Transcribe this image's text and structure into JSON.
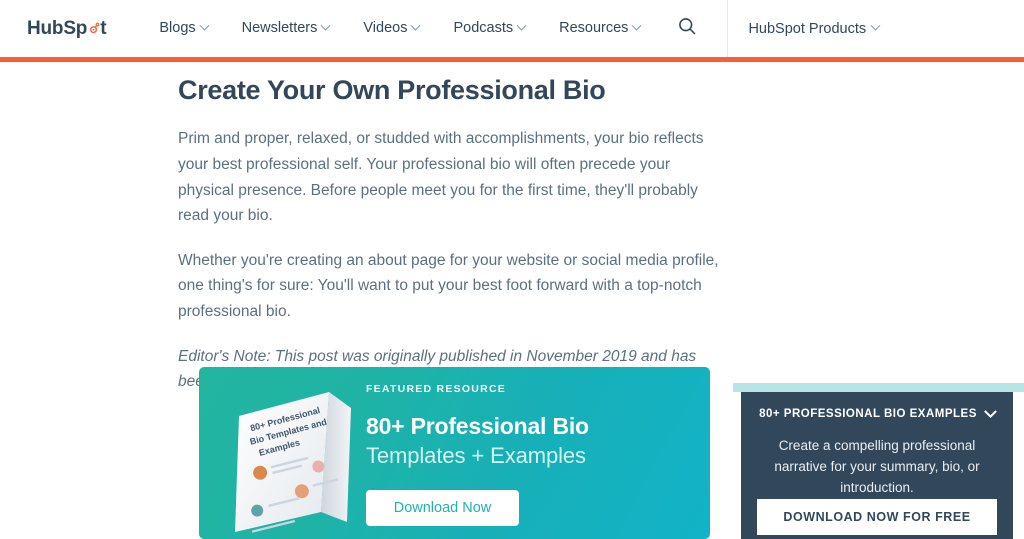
{
  "header": {
    "logo": {
      "text_a": "HubSp",
      "text_b": "t",
      "icon": "hubspot-sprocket-icon"
    },
    "nav_items": [
      {
        "label": "Blogs",
        "has_caret": true
      },
      {
        "label": "Newsletters",
        "has_caret": true
      },
      {
        "label": "Videos",
        "has_caret": true
      },
      {
        "label": "Podcasts",
        "has_caret": true
      },
      {
        "label": "Resources",
        "has_caret": true
      }
    ],
    "search_icon": "search-icon",
    "products": {
      "label": "HubSpot Products",
      "has_caret": true
    },
    "accent_bar_color": "#ff5c35"
  },
  "article": {
    "title": "Create Your Own Professional Bio",
    "paragraph_1": "Prim and proper, relaxed, or studded with accomplishments, your bio reflects your best professional self. Your professional bio will often precede your physical presence. Before people meet you for the first time, they'll probably read your bio.",
    "paragraph_2": "Whether you're creating an about page for your website or social media profile, one thing's for sure: You'll want to put your best foot forward with a top-notch professional bio.",
    "editor_note": "Editor's Note: This post was originally published in November 2019 and has been updated for accuracy and comprehensiveness."
  },
  "cta_banner": {
    "eyebrow": "FEATURED RESOURCE",
    "heading": "80+ Professional Bio",
    "subheading": "Templates + Examples",
    "button_label": "Download Now",
    "book_cover_title": "80+ Professional Bio Templates and Examples",
    "gradient_from": "#22b5a0",
    "gradient_to": "#12b3c8",
    "button_text_color": "#20b2ab"
  },
  "sidebar_cta": {
    "strip_color": "#b7e4e4",
    "panel_color": "#33475b",
    "title": "80+ PROFESSIONAL BIO EXAMPLES",
    "chevron_icon": "chevron-down-icon",
    "description": "Create a compelling professional narrative for your summary, bio, or introduction.",
    "button_label": "DOWNLOAD NOW FOR FREE"
  }
}
